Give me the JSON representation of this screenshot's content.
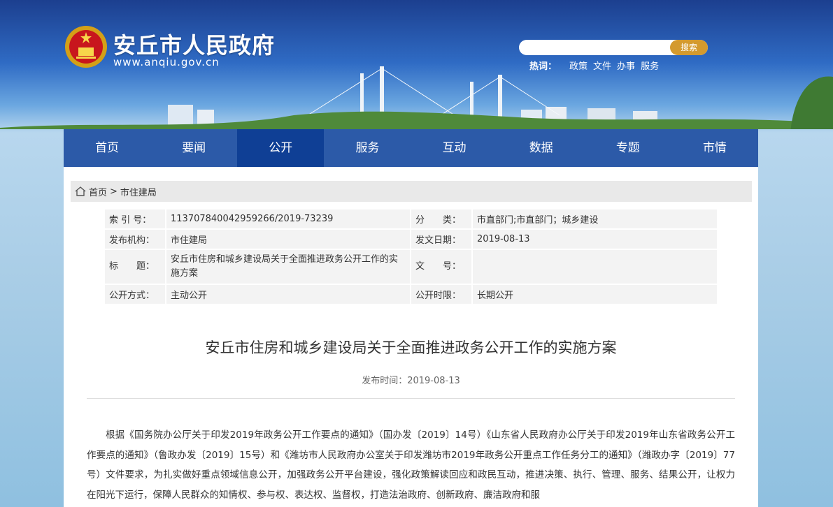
{
  "header": {
    "site_title": "安丘市人民政府",
    "site_url": "www.anqiu.gov.cn",
    "search": {
      "placeholder": "",
      "button_label": "搜索"
    },
    "hot": {
      "label": "热词：",
      "links": [
        "政策",
        "文件",
        "办事",
        "服务"
      ]
    }
  },
  "nav": {
    "items": [
      {
        "label": "首页"
      },
      {
        "label": "要闻"
      },
      {
        "label": "公开"
      },
      {
        "label": "服务"
      },
      {
        "label": "互动"
      },
      {
        "label": "数据"
      },
      {
        "label": "专题"
      },
      {
        "label": "市情"
      }
    ]
  },
  "breadcrumb": {
    "home": "首页",
    "separator": ">",
    "current": "市住建局"
  },
  "meta": {
    "index_label": "索 引 号：",
    "index_value": "113707840042959266/2019-73239",
    "category_label": "分　　类：",
    "category_value": "市直部门;市直部门；城乡建设",
    "publisher_label": "发布机构：",
    "publisher_value": "市住建局",
    "date_label": "发文日期：",
    "date_value": "2019-08-13",
    "title_label": "标　　题：",
    "title_value": "安丘市住房和城乡建设局关于全面推进政务公开工作的实施方案",
    "docno_label": "文　　号：",
    "docno_value": "",
    "mode_label": "公开方式：",
    "mode_value": "主动公开",
    "term_label": "公开时限：",
    "term_value": "长期公开"
  },
  "article": {
    "title": "安丘市住房和城乡建设局关于全面推进政务公开工作的实施方案",
    "pub_time": "发布时间：2019-08-13",
    "body": "根据《国务院办公厅关于印发2019年政务公开工作要点的通知》（国办发〔2019〕14号）《山东省人民政府办公厅关于印发2019年山东省政务公开工作要点的通知》（鲁政办发〔2019〕15号）和《潍坊市人民政府办公室关于印发潍坊市2019年政务公开重点工作任务分工的通知》（潍政办字〔2019〕77号）文件要求，为扎实做好重点领域信息公开，加强政务公开平台建设，强化政策解读回应和政民互动，推进决策、执行、管理、服务、结果公开，让权力在阳光下运行，保障人民群众的知情权、参与权、表达权、监督权，打造法治政府、创新政府、廉洁政府和服"
  },
  "colors": {
    "nav_bg": "#2c5aa8",
    "nav_active": "#0f3f95",
    "search_btn": "#d49a2e"
  }
}
